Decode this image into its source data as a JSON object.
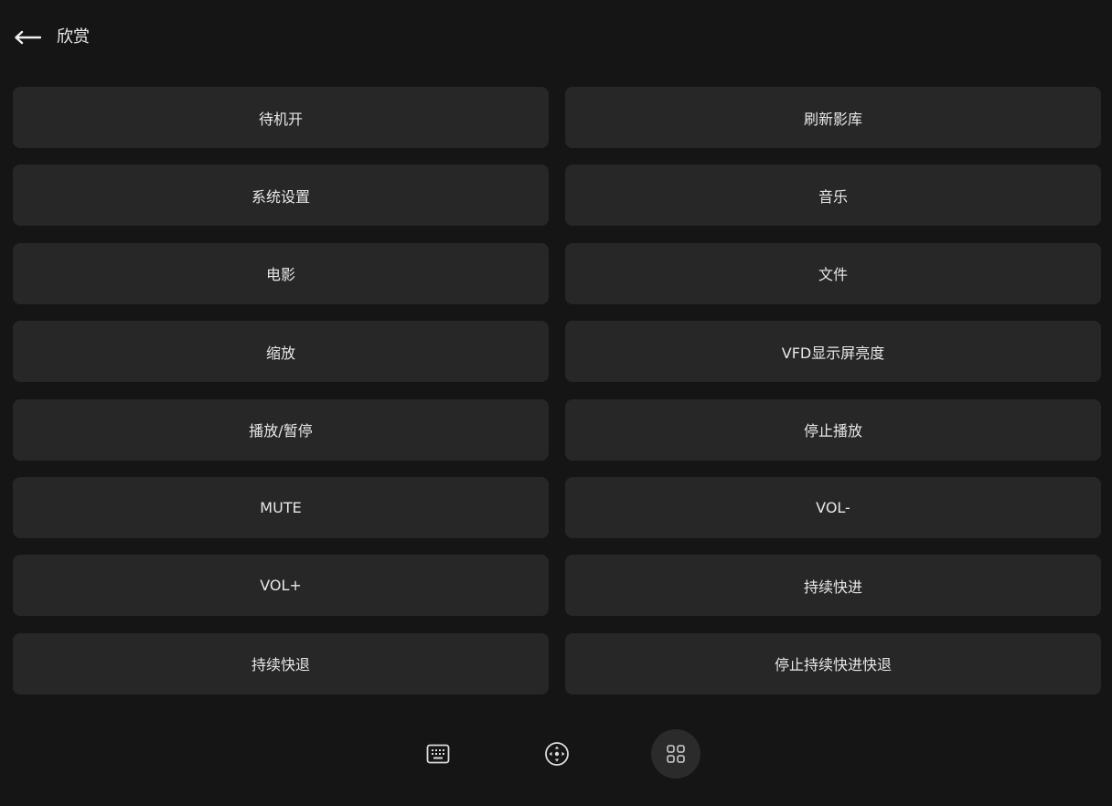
{
  "header": {
    "title": "欣赏",
    "back_icon": "arrow-left-icon"
  },
  "commands": [
    {
      "label": "待机开"
    },
    {
      "label": "刷新影库"
    },
    {
      "label": "系统设置"
    },
    {
      "label": "音乐"
    },
    {
      "label": "电影"
    },
    {
      "label": "文件"
    },
    {
      "label": "缩放"
    },
    {
      "label": "VFD显示屏亮度"
    },
    {
      "label": "播放/暂停"
    },
    {
      "label": "停止播放"
    },
    {
      "label": "MUTE"
    },
    {
      "label": "VOL-"
    },
    {
      "label": "VOL+"
    },
    {
      "label": "持续快进"
    },
    {
      "label": "持续快退"
    },
    {
      "label": "停止持续快进快退"
    }
  ],
  "bottom_tabs": [
    {
      "icon": "keyboard-icon",
      "active": false
    },
    {
      "icon": "dpad-icon",
      "active": false
    },
    {
      "icon": "grid-apps-icon",
      "active": true
    }
  ],
  "colors": {
    "background": "#151515",
    "button": "#272727",
    "active_tab": "#2b2b2b",
    "text": "#e8e8e8"
  }
}
